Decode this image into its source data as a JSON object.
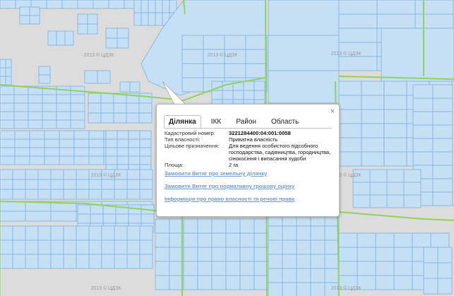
{
  "map": {
    "watermark": "2013 © ЦДЗК",
    "colors": {
      "background": "#dcdcdc",
      "parcel_fill": "#c5dff5",
      "parcel_stroke": "#7fb1e0",
      "boundary": "#8fd35c"
    }
  },
  "popup": {
    "tabs": [
      {
        "label": "Ділянка",
        "active": true
      },
      {
        "label": "ІКК",
        "active": false
      },
      {
        "label": "Район",
        "active": false
      },
      {
        "label": "Область",
        "active": false
      }
    ],
    "close_label": "×",
    "fields": [
      {
        "label": "Кадастровий номер:",
        "value": "3221284400:04:001:0058"
      },
      {
        "label": "Тип власності:",
        "value": "Приватна власність"
      },
      {
        "label": "Цільове призначення:",
        "value": "Для ведення особистого підсобного господарства, садівництва, городництва, сінокосіння і випасання худоби"
      },
      {
        "label": "Площа:",
        "value": "2 га"
      }
    ],
    "links": [
      "Замовити Витяг про земельну ділянку",
      "Замовити Витяг про нормативну грошову оцінку",
      "Інформація про право власності та речові права"
    ]
  }
}
